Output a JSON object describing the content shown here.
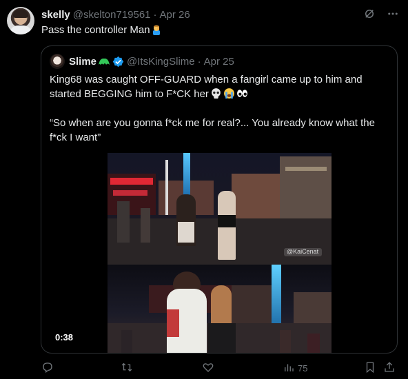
{
  "post": {
    "author_name": "skelly",
    "author_handle": "@skelton719561",
    "separator": "·",
    "date": "Apr 26",
    "text": "Pass the controller Man",
    "text_emoji": "man-facepalming-emoji"
  },
  "quoted": {
    "author_name": "Slime",
    "author_handle": "@ItsKingSlime",
    "separator": "·",
    "date": "Apr 25",
    "line1": "King68 was caught OFF-GUARD when a fangirl came up to him and",
    "line2": "started BEGGING him to F*CK her",
    "line3": "“So when are you gonna f*ck me for real?... You already know what the",
    "line4": "f*ck I want”",
    "emojis": [
      "skull-emoji",
      "loudly-crying-emoji",
      "eyes-emoji"
    ],
    "video_duration": "0:38",
    "video_watermark": "@KaiCenat"
  },
  "actions": {
    "reply_count": "",
    "repost_count": "",
    "like_count": "",
    "views_count": "75"
  },
  "colors": {
    "background": "#000000",
    "text_primary": "#e7e9ea",
    "text_secondary": "#71767b",
    "border": "#2f3336",
    "verified_blue": "#1d9bf0"
  }
}
